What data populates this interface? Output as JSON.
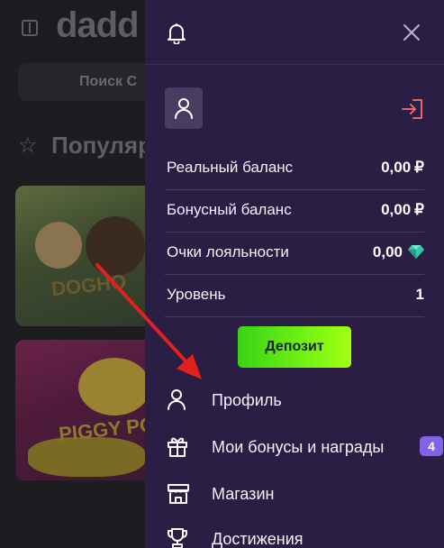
{
  "background": {
    "logo_text": "dadd",
    "search_label": "Поиск С",
    "section_title": "Популяр",
    "game_cards": [
      {
        "caption": "DOGHO",
        "art": "dog-house-megaways"
      },
      {
        "caption": "PIGGY POWER",
        "art": "piggy-power"
      }
    ]
  },
  "panel": {
    "icons": {
      "notifications": "bell-icon",
      "close": "close-icon",
      "user": "user-icon",
      "login": "login-icon"
    },
    "stats": [
      {
        "label": "Реальный баланс",
        "value": "0,00",
        "currency": "₽"
      },
      {
        "label": "Бонусный баланс",
        "value": "0,00",
        "currency": "₽"
      },
      {
        "label": "Очки лояльности",
        "value": "0,00",
        "icon": "diamond-icon"
      },
      {
        "label": "Уровень",
        "value": "1"
      }
    ],
    "deposit_label": "Депозит",
    "menu": [
      {
        "label": "Профиль",
        "icon": "user-icon"
      },
      {
        "label": "Мои бонусы и награды",
        "icon": "gift-icon",
        "badge": "4"
      },
      {
        "label": "Магазин",
        "icon": "store-icon"
      },
      {
        "label": "Достижения",
        "icon": "trophy-icon"
      }
    ]
  },
  "colors": {
    "panel_bg": "#2b1e44",
    "deposit_gradient_start": "#39d314",
    "deposit_gradient_end": "#a4ff12",
    "badge": "#8263e8",
    "login_icon": "#e8646e",
    "annotation_arrow": "#e0211d"
  }
}
